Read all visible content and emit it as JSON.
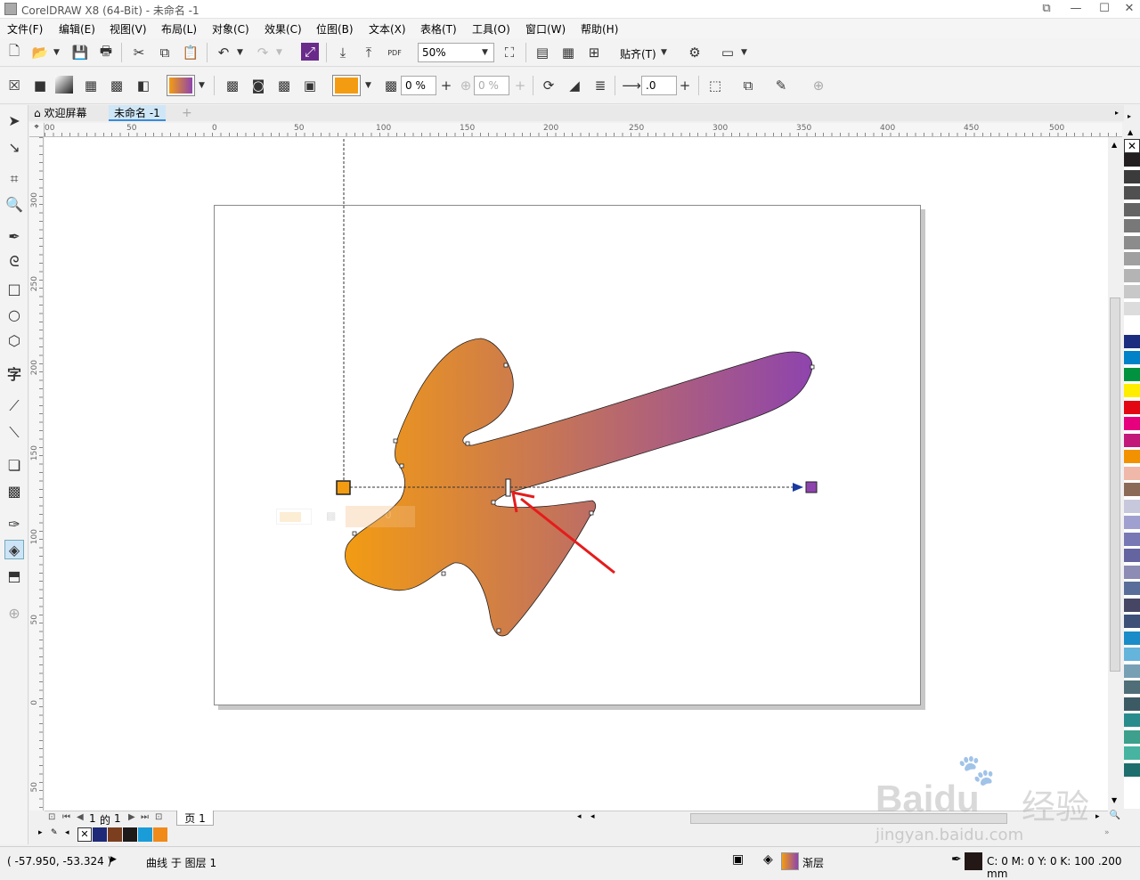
{
  "title": {
    "text": "CorelDRAW X8 (64-Bit) - 未命名 -1"
  },
  "window_controls": {
    "restore_small": "⧉",
    "minimize": "—",
    "maximize": "☐",
    "close": "✕"
  },
  "menu": {
    "items": [
      "文件(F)",
      "编辑(E)",
      "视图(V)",
      "布局(L)",
      "对象(C)",
      "效果(C)",
      "位图(B)",
      "文本(X)",
      "表格(T)",
      "工具(O)",
      "窗口(W)",
      "帮助(H)"
    ]
  },
  "std_toolbar": {
    "zoom": "50%",
    "snap_label": "贴齐(T)",
    "pdf_label": "PDF"
  },
  "prop_bar": {
    "node_color": "#f39c12",
    "transparency1": "0 %",
    "transparency2": "0 %",
    "offset": ".0"
  },
  "tabs": {
    "welcome": "欢迎屏幕",
    "document": "未命名 -1"
  },
  "ruler": {
    "h_labels": [
      "00",
      "50",
      "0",
      "50",
      "100",
      "150",
      "200",
      "250",
      "300",
      "350",
      "400",
      "450",
      "500"
    ],
    "v_labels": [
      "300",
      "250",
      "200",
      "150",
      "100",
      "50",
      "0",
      "50"
    ]
  },
  "gradient": {
    "start_color": "#f39c12",
    "end_color": "#8e44ad",
    "floating_value": "0"
  },
  "page_nav": {
    "current": "1",
    "of_label": "的",
    "total": "1",
    "page_tab": "页 1"
  },
  "document_palette": [
    "#1e2a78",
    "#7b3f1f",
    "#1e1a1a",
    "#1a9cd8",
    "#f08a18"
  ],
  "color_palette": [
    "#231f20",
    "#3b3b3b",
    "#505050",
    "#646464",
    "#787878",
    "#8c8c8c",
    "#a0a0a0",
    "#b4b4b4",
    "#c8c8c8",
    "#dcdcdc",
    "#ffffff",
    "#1b2d7f",
    "#0082c8",
    "#00923f",
    "#ffed00",
    "#e30613",
    "#e6007e",
    "#c2187a",
    "#f39200",
    "#f0b8a8",
    "#8c6a58",
    "#c8c8dc",
    "#a0a0d0",
    "#7878b4",
    "#6464a0",
    "#8c8cb4",
    "#5a6e9a",
    "#464664",
    "#3c5078",
    "#1a8cc8",
    "#64b4dc",
    "#78a0b4",
    "#506e78",
    "#3c5a64",
    "#288c8c",
    "#3ca08c",
    "#46b4a0",
    "#1e6e6e"
  ],
  "status": {
    "coords": "( -57.950, -53.324 )",
    "object_info": "曲线 于 图层 1",
    "fill_label": "渐层",
    "outline_info": "C: 0 M: 0 Y: 0 K: 100  .200 mm",
    "outline_swatch": "#231815"
  },
  "watermark": {
    "brand": "Baidu",
    "cn": "经验",
    "url": "jingyan.baidu.com"
  }
}
